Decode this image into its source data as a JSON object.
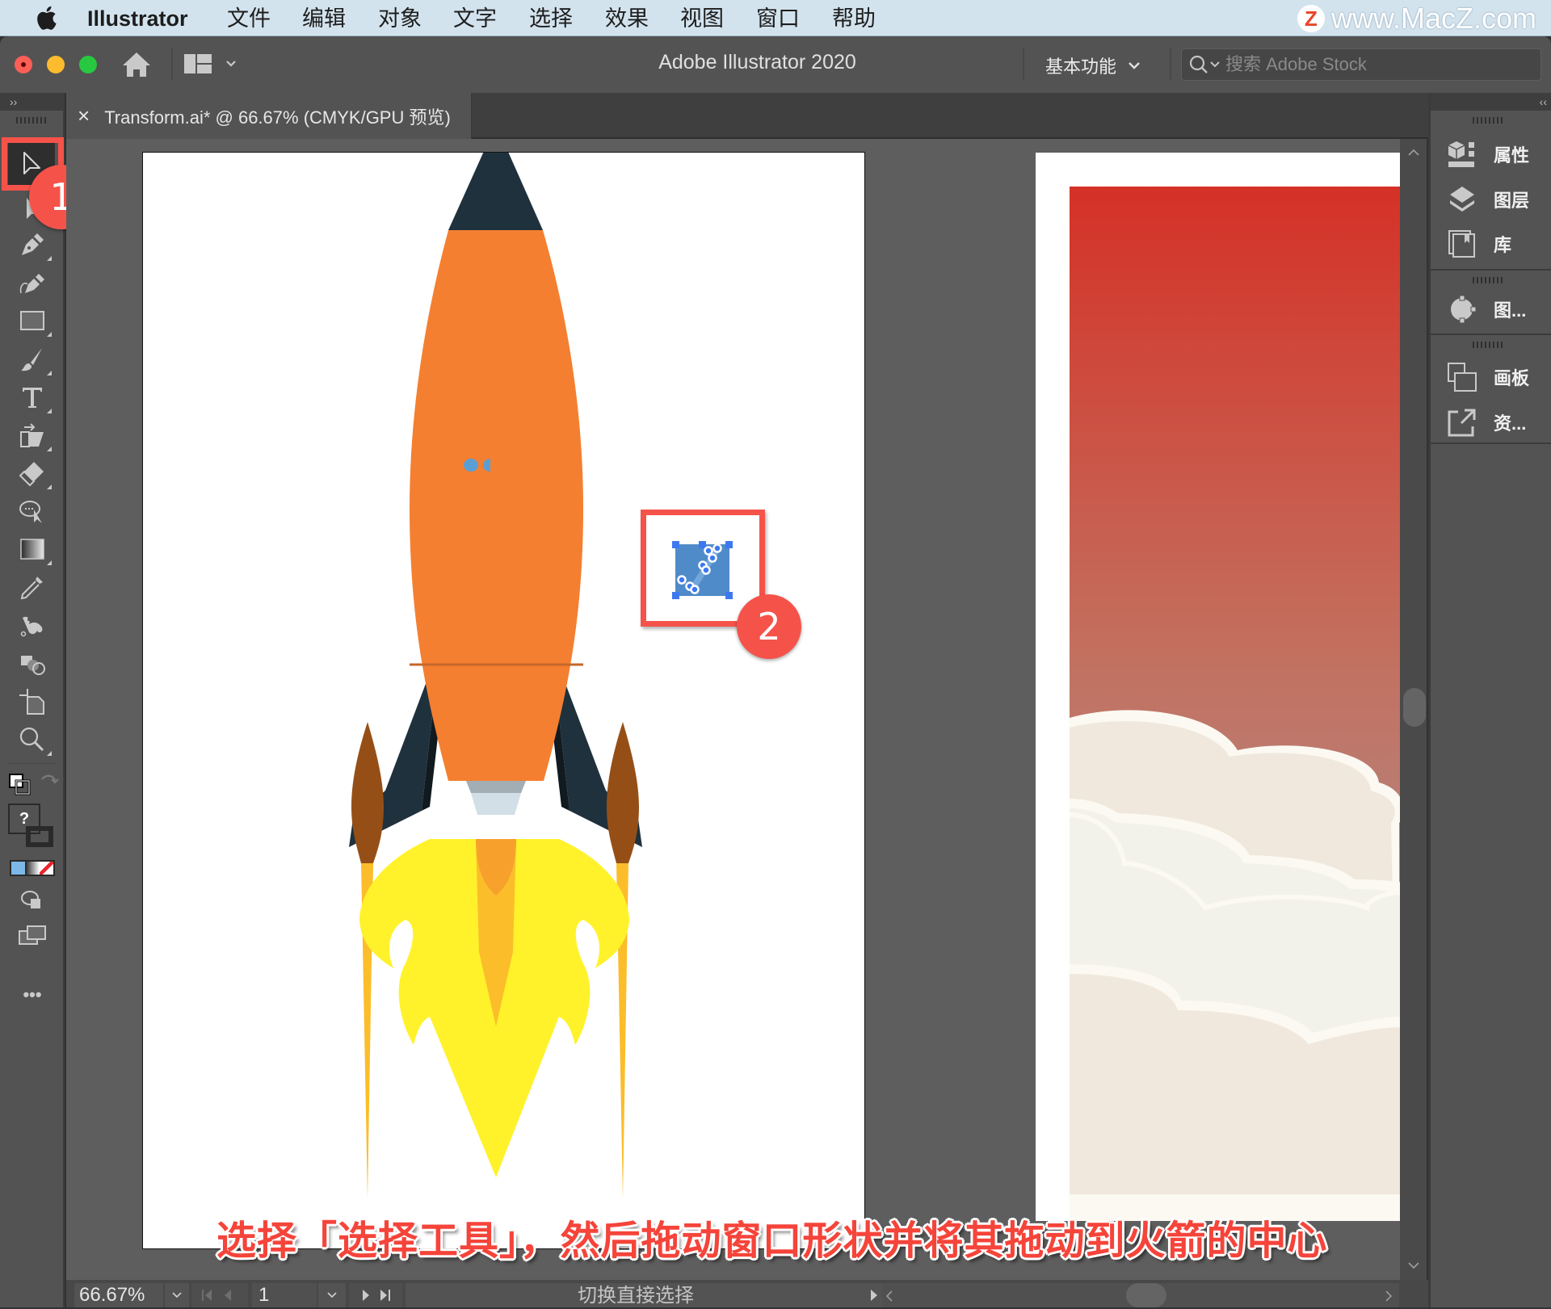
{
  "menubar": {
    "app_name": "Illustrator",
    "items": [
      "文件",
      "编辑",
      "对象",
      "文字",
      "选择",
      "效果",
      "视图",
      "窗口",
      "帮助"
    ],
    "watermark": "www.MacZ.com",
    "watermark_logo": "Z"
  },
  "titlebar": {
    "title": "Adobe Illustrator 2020",
    "workspace_label": "基本功能",
    "search_placeholder": "搜索 Adobe Stock"
  },
  "document_tab": {
    "close_glyph": "×",
    "label": "Transform.ai* @ 66.67% (CMYK/GPU 预览)"
  },
  "toolbar": {
    "collapse_glyph": "››",
    "tools": [
      {
        "name": "selection-tool",
        "active": true
      },
      {
        "name": "direct-selection-tool"
      },
      {
        "name": "pen-tool"
      },
      {
        "name": "curvature-tool"
      },
      {
        "name": "rectangle-tool"
      },
      {
        "name": "paintbrush-tool"
      },
      {
        "name": "type-tool"
      },
      {
        "name": "free-transform-tool"
      },
      {
        "name": "eraser-tool"
      },
      {
        "name": "lasso-tool"
      },
      {
        "name": "gradient-tool"
      },
      {
        "name": "eyedropper-tool"
      },
      {
        "name": "puppet-warp-tool"
      },
      {
        "name": "shape-builder-tool"
      },
      {
        "name": "artboard-tool"
      },
      {
        "name": "zoom-tool"
      }
    ],
    "fill_stroke_unknown": "?",
    "more_glyph": "•••"
  },
  "annotations": {
    "step1": "1",
    "step2": "2",
    "color": "#f5534a"
  },
  "caption": "选择「选择工具」，然后拖动窗口形状并将其拖动到火箭的中心",
  "right_panel": {
    "collapse_glyph": "‹‹",
    "groups": [
      {
        "items": [
          {
            "icon": "properties-icon",
            "label": "属性"
          },
          {
            "icon": "layers-icon",
            "label": "图层"
          },
          {
            "icon": "libraries-icon",
            "label": "库"
          }
        ]
      },
      {
        "items": [
          {
            "icon": "recolor-icon",
            "label": "图..."
          }
        ]
      },
      {
        "items": [
          {
            "icon": "artboards-icon",
            "label": "画板"
          },
          {
            "icon": "asset-export-icon",
            "label": "资..."
          }
        ]
      }
    ]
  },
  "statusbar": {
    "zoom_value": "66.67%",
    "artboard_number": "1",
    "status_text": "切换直接选择"
  },
  "artwork": {
    "rocket_colors": {
      "body": "#f47f31",
      "nose": "#1f313d",
      "fins": "#1f313d",
      "boosters": "#954f16",
      "flame_outer": "#fff22b",
      "flame_inner": "#fcbd2b",
      "window": "#5a9fd4"
    },
    "sky_gradient": [
      "#d53127",
      "#a39fa6"
    ],
    "cloud_colors": [
      "#f0e8dd",
      "#f2f1ea",
      "#fbf9f2"
    ],
    "selected_shape_color": "#4f8bc8",
    "selection_handle_color": "#3d78f0"
  }
}
